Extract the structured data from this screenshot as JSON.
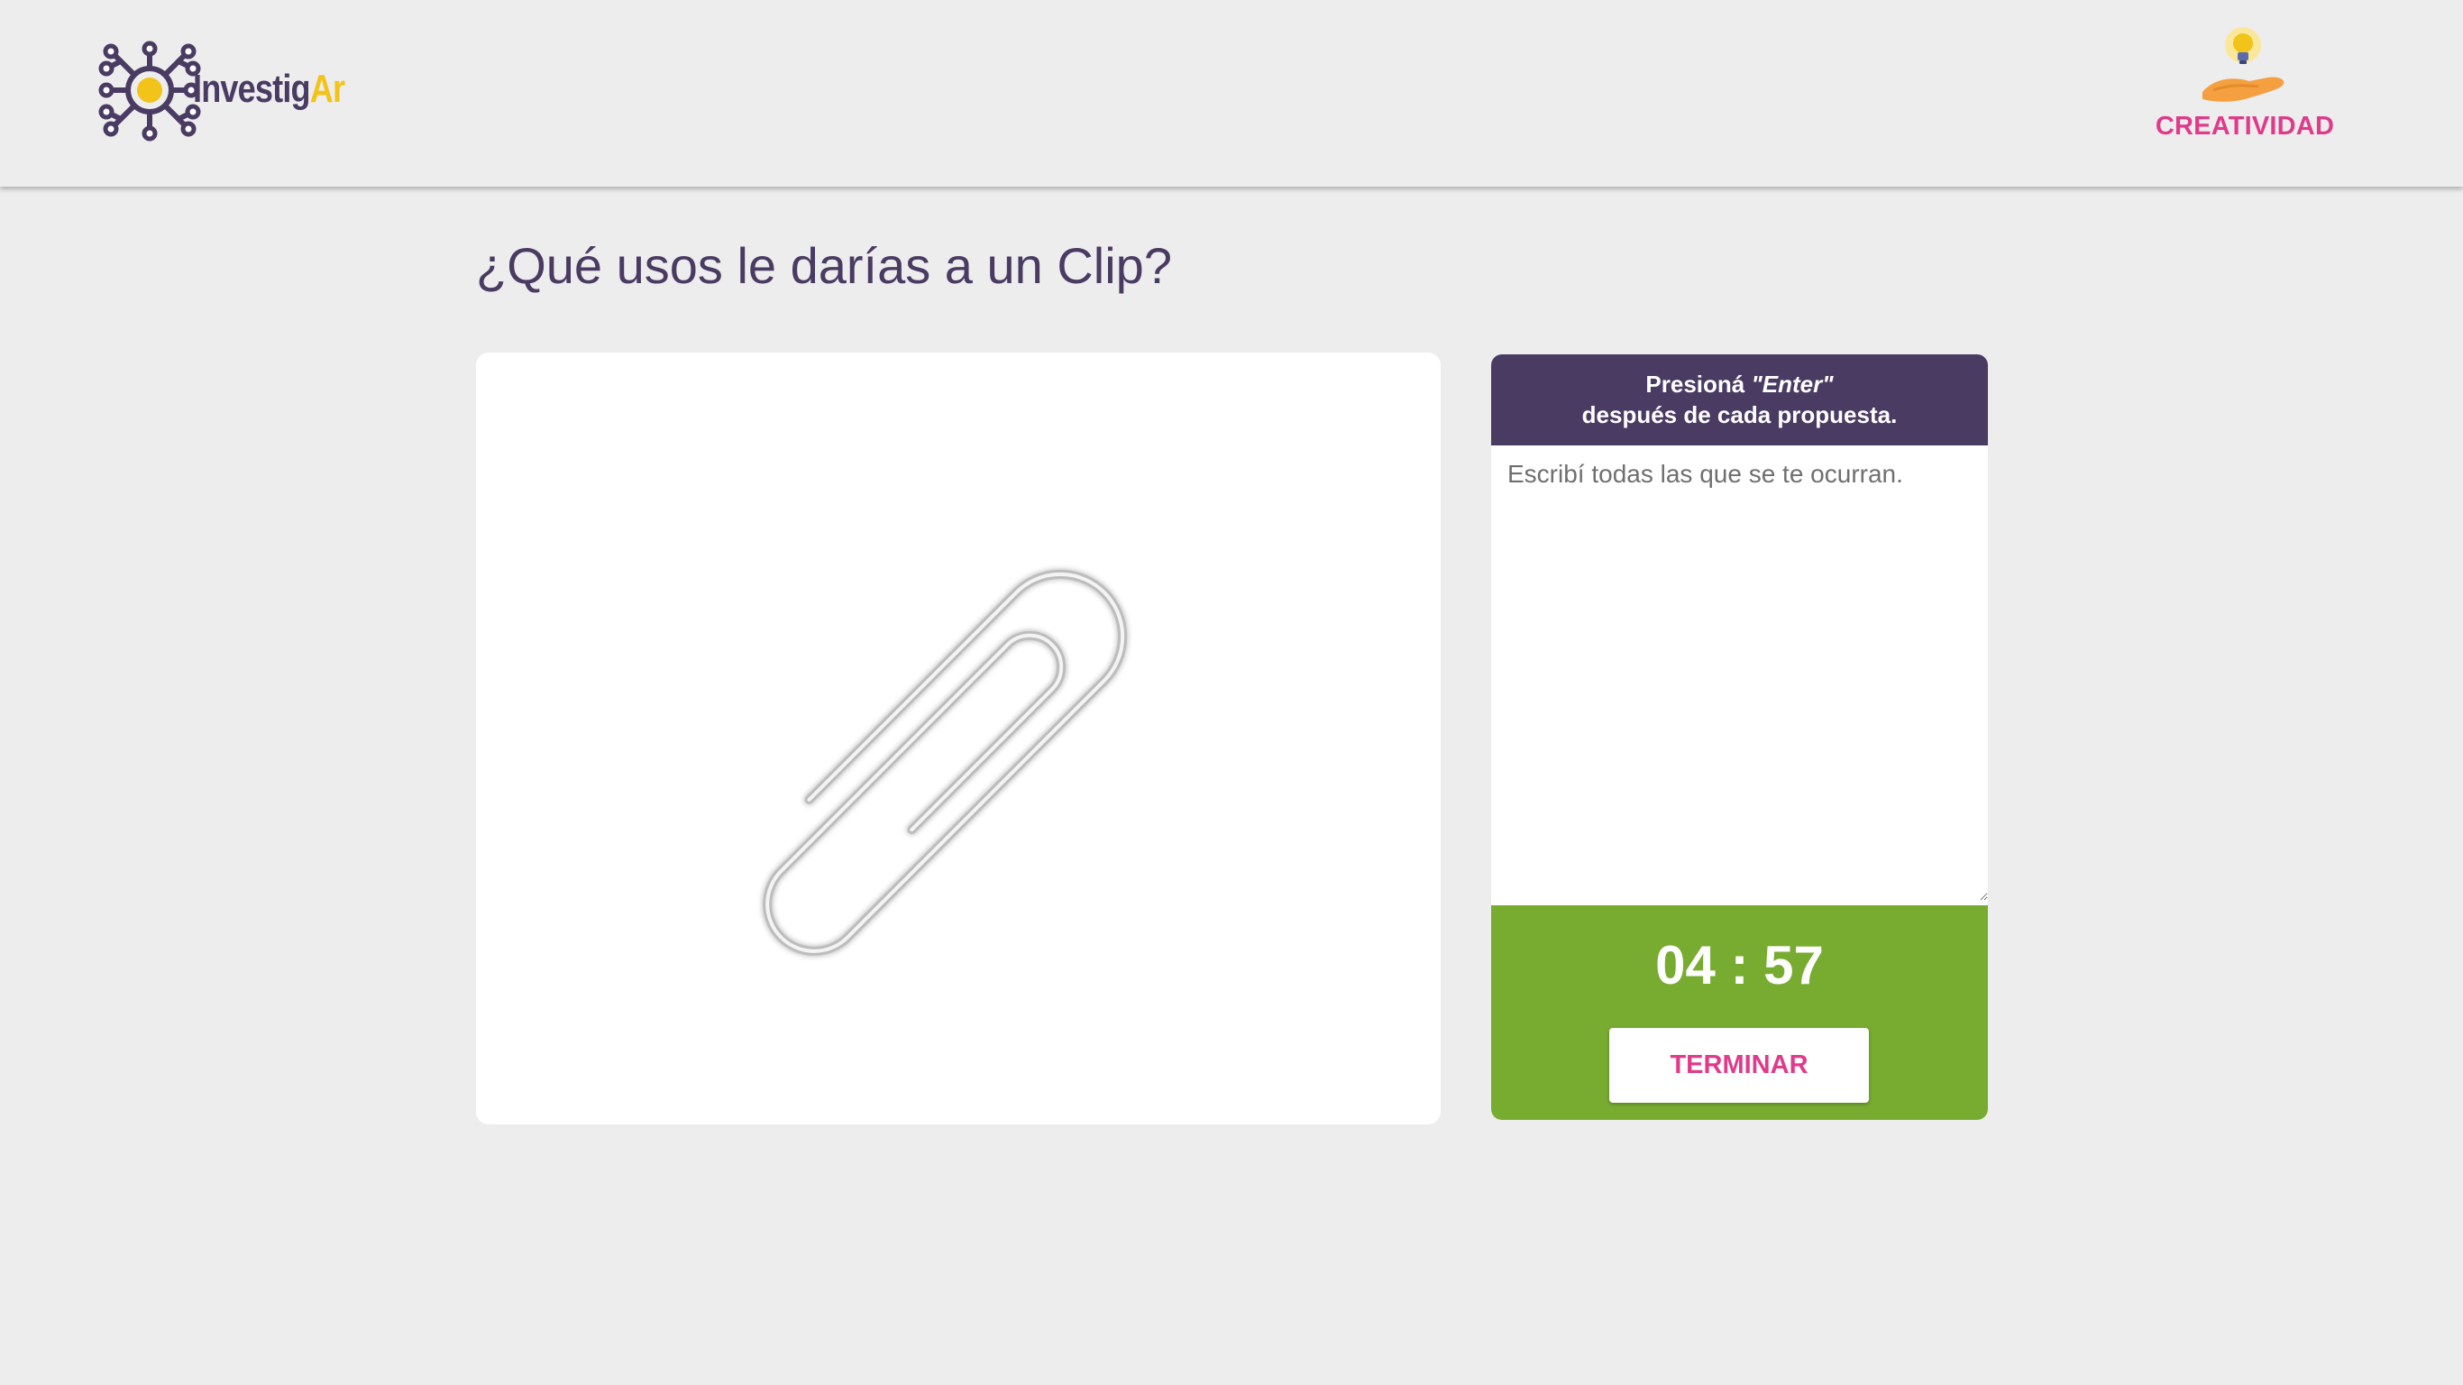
{
  "brand": {
    "name_part1": "Investig",
    "name_part2": "Ar",
    "accent_color": "#f2c319",
    "primary_color": "#4a3b63"
  },
  "header": {
    "section_icon": "lightbulb-hand-icon",
    "section_label": "CREATIVIDAD",
    "section_color": "#e03a8a"
  },
  "main": {
    "question": "¿Qué usos le darías a un Clip?",
    "image_icon": "paperclip-icon"
  },
  "panel": {
    "instruction_line1_a": "Presioná ",
    "instruction_line1_b": "\"Enter\"",
    "instruction_line2": "después de cada propuesta.",
    "answer_placeholder": "Escribí todas las que se te ocurran.",
    "answer_value": "",
    "timer": "04 : 57",
    "finish_label": "TERMINAR",
    "timer_bg_color": "#78ac31"
  }
}
